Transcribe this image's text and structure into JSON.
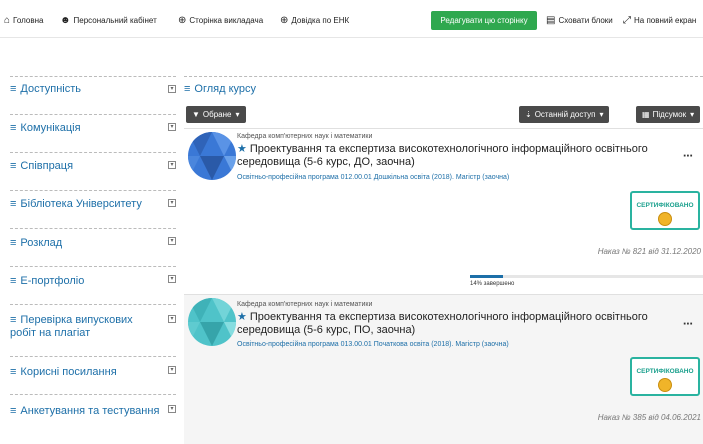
{
  "nav": {
    "home": "Головна",
    "cabinet": "Персональний кабінет",
    "teacher_page": "Сторінка викладача",
    "help": "Довідка по ЕНК",
    "edit": "Редагувати цю сторінку",
    "hide_blocks": "Сховати блоки",
    "fullscreen": "На повний екран"
  },
  "sidebar": {
    "items": [
      {
        "label": "Доступність"
      },
      {
        "label": "Комунікація"
      },
      {
        "label": "Співпраця"
      },
      {
        "label": "Бібліотека Університету"
      },
      {
        "label": "Розклад"
      },
      {
        "label": "Е-портфоліо"
      },
      {
        "label": "Перевірка випускових робіт на плагіат"
      },
      {
        "label": "Корисні посилання"
      },
      {
        "label": "Анкетування та тестування"
      }
    ]
  },
  "main": {
    "title": "Огляд курсу",
    "filter": "Обране",
    "sort": "Останній доступ",
    "view": "Підсумок",
    "courses": [
      {
        "dept": "Кафедра комп'ютерних наук і математики",
        "title": "Проектування та експертиза високотехнологічного інформаційного освітнього середовища (5-6 курс, ДО, заочна)",
        "program": "Освітньо-професійна програма 012.00.01 Дошкільна освіта (2018). Магістр (заочна)",
        "certificate": "СЕРТИФІКОВАНО",
        "order": "Наказ № 821 від 31.12.2020",
        "progress_value": 0.14,
        "progress_text": "14% завершено"
      },
      {
        "dept": "Кафедра комп'ютерних наук і математики",
        "title": "Проектування та експертиза високотехнологічного інформаційного освітнього середовища (5-6 курс, ПО, заочна)",
        "program": "Освітньо-професійна програма 013.00.01 Початкова освіта (2018). Магістр (заочна)",
        "certificate": "СЕРТИФІКОВАНО",
        "order": "Наказ № 385 від 04.06.2021"
      }
    ]
  },
  "colors": {
    "accent": "#1d6fa8",
    "edit_button": "#2fa84f",
    "certificate": "#2ab3a0"
  }
}
